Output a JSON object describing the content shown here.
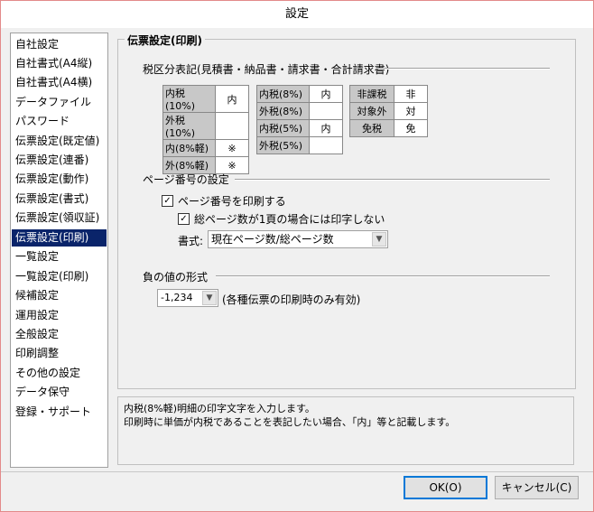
{
  "window": {
    "title": "設定"
  },
  "sidebar": {
    "items": [
      {
        "label": "自社設定",
        "selected": false
      },
      {
        "label": "自社書式(A4縦)",
        "selected": false
      },
      {
        "label": "自社書式(A4横)",
        "selected": false
      },
      {
        "label": "データファイル",
        "selected": false
      },
      {
        "label": "パスワード",
        "selected": false
      },
      {
        "label": "伝票設定(既定値)",
        "selected": false
      },
      {
        "label": "伝票設定(連番)",
        "selected": false
      },
      {
        "label": "伝票設定(動作)",
        "selected": false
      },
      {
        "label": "伝票設定(書式)",
        "selected": false
      },
      {
        "label": "伝票設定(領収証)",
        "selected": false
      },
      {
        "label": "伝票設定(印刷)",
        "selected": true
      },
      {
        "label": "一覧設定",
        "selected": false
      },
      {
        "label": "一覧設定(印刷)",
        "selected": false
      },
      {
        "label": "候補設定",
        "selected": false
      },
      {
        "label": "運用設定",
        "selected": false
      },
      {
        "label": "全般設定",
        "selected": false
      },
      {
        "label": "印刷調整",
        "selected": false
      },
      {
        "label": "その他の設定",
        "selected": false
      },
      {
        "label": "データ保守",
        "selected": false
      },
      {
        "label": "登録・サポート",
        "selected": false
      }
    ]
  },
  "panel": {
    "title": "伝票設定(印刷)",
    "tax_section": {
      "label": "税区分表記(見積書・納品書・請求書・合計請求書)",
      "table1": [
        {
          "label": "内税(10%)",
          "value": "内"
        },
        {
          "label": "外税(10%)",
          "value": ""
        },
        {
          "label": "内(8%軽)",
          "value": "※"
        },
        {
          "label": "外(8%軽)",
          "value": "※"
        }
      ],
      "table2": [
        {
          "label": "内税(8%)",
          "value": "内"
        },
        {
          "label": "外税(8%)",
          "value": ""
        },
        {
          "label": "内税(5%)",
          "value": "内"
        },
        {
          "label": "外税(5%)",
          "value": ""
        }
      ],
      "table3": [
        {
          "label": "非課税",
          "value": "非"
        },
        {
          "label": "対象外",
          "value": "対"
        },
        {
          "label": "免税",
          "value": "免"
        }
      ]
    },
    "page_section": {
      "label": "ページ番号の設定",
      "print_page_number": {
        "label": "ページ番号を印刷する",
        "checked": true
      },
      "skip_single_page": {
        "label": "総ページ数が1頁の場合には印字しない",
        "checked": true
      },
      "format_label": "書式:",
      "format_value": "現在ページ数/総ページ数"
    },
    "negative_section": {
      "label": "負の値の形式",
      "value": "-1,234",
      "note": "(各種伝票の印刷時のみ有効)"
    }
  },
  "description": {
    "line1": "内税(8%軽)明細の印字文字を入力します。",
    "line2": "印刷時に単価が内税であることを表記したい場合、「内」等と記載します。"
  },
  "buttons": {
    "ok": "OK(O)",
    "cancel": "キャンセル(C)"
  }
}
